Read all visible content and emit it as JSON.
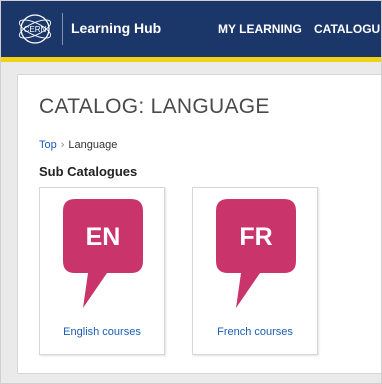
{
  "header": {
    "brand": "Learning Hub",
    "nav": [
      "MY LEARNING",
      "CATALOGUES"
    ],
    "logo_text": "CERN",
    "colors": {
      "bar": "#1b3769",
      "accent": "#f1d214"
    }
  },
  "page": {
    "title": "CATALOG: LANGUAGE",
    "breadcrumb": {
      "top": "Top",
      "separator": "›",
      "current": "Language"
    },
    "section_title": "Sub Catalogues",
    "cards": [
      {
        "badge": "EN",
        "label": "English courses",
        "icon": "speech-bubble-icon",
        "color": "#c9356b"
      },
      {
        "badge": "FR",
        "label": "French courses",
        "icon": "speech-bubble-icon",
        "color": "#c9356b"
      }
    ]
  }
}
